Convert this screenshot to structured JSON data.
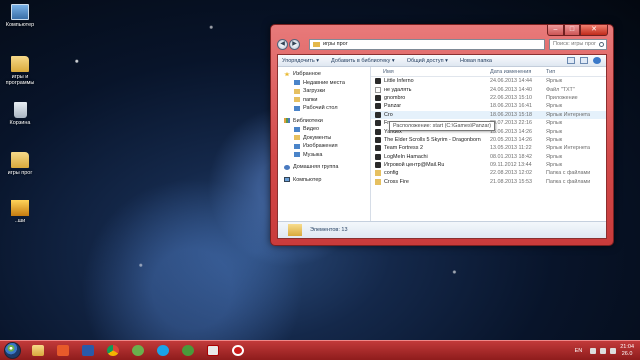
{
  "desktop": {
    "icons": [
      {
        "label": "Компьютер",
        "icon": "computer-icon"
      },
      {
        "label": "игры и программы",
        "icon": "folder-icon"
      },
      {
        "label": "Корзина",
        "icon": "recycle-bin-icon"
      },
      {
        "label": "игры прог",
        "icon": "folder-icon"
      },
      {
        "label": "..ши",
        "icon": "folder-icon"
      }
    ]
  },
  "window": {
    "address": "игры прог",
    "search_placeholder": "Поиск: игры прог",
    "toolbar": {
      "organize": "Упорядочить ▾",
      "include": "Добавить в библиотеку ▾",
      "share": "Общий доступ ▾",
      "new_folder": "Новая папка"
    },
    "nav": {
      "favorites": "Избранное",
      "favorites_items": [
        "Недавние места",
        "Загрузки",
        "папки",
        "Рабочий стол"
      ],
      "libraries": "Библиотеки",
      "libraries_items": [
        "Видео",
        "Документы",
        "Изображения",
        "Музыка"
      ],
      "homegroup": "Домашняя группа",
      "computer": "Компьютер"
    },
    "columns": {
      "name": "Имя",
      "date": "Дата изменения",
      "type": "Тип"
    },
    "files": [
      {
        "name": "Little Inferno",
        "date": "24.06.2013 14:44",
        "type": "Ярлык",
        "icon": "exe"
      },
      {
        "name": "не удалять",
        "date": "24.06.2013 14:40",
        "type": "Файл \"TXT\"",
        "icon": "txt"
      },
      {
        "name": "gnombro",
        "date": "22.06.2013 15:10",
        "type": "Приложение",
        "icon": "exe"
      },
      {
        "name": "Panzar",
        "date": "18.06.2013 16:41",
        "type": "Ярлык",
        "icon": "exe"
      },
      {
        "name": "Cro",
        "date": "18.06.2013 15:18",
        "type": "Ярлык Интернета",
        "icon": "exe"
      },
      {
        "name": "Fraps",
        "date": "29.07.2013 22:16",
        "type": "Ярлык",
        "icon": "exe"
      },
      {
        "name": "Yandex",
        "date": "15.06.2013 14:26",
        "type": "Ярлык",
        "icon": "exe"
      },
      {
        "name": "The Elder Scrolls 5 Skyrim - Dragonborn",
        "date": "20.05.2013 14:26",
        "type": "Ярлык",
        "icon": "exe"
      },
      {
        "name": "Team Fortress 2",
        "date": "13.05.2013 11:22",
        "type": "Ярлык Интернета",
        "icon": "exe"
      },
      {
        "name": "LogMeIn Hamachi",
        "date": "08.01.2013 18:42",
        "type": "Ярлык",
        "icon": "exe"
      },
      {
        "name": "Игровой центр@Mail.Ru",
        "date": "09.11.2012 13:44",
        "type": "Ярлык",
        "icon": "exe"
      },
      {
        "name": "config",
        "date": "22.08.2013 12:02",
        "type": "Папка с файлами",
        "icon": "folder"
      },
      {
        "name": "Cross Fire",
        "date": "21.08.2013 15:53",
        "type": "Папка с файлами",
        "icon": "folder"
      }
    ],
    "tooltip": "Расположение: start (C:\\Games\\Panzar)",
    "status": "Элементов: 13"
  },
  "taskbar": {
    "apps": [
      "explorer-icon",
      "media-player-icon",
      "word-icon",
      "chrome-icon",
      "utorrent-icon",
      "skype-icon",
      "browser-icon",
      "yandex-icon",
      "opera-icon"
    ],
    "lang": "EN",
    "time": "21:04",
    "date": "26.0"
  }
}
